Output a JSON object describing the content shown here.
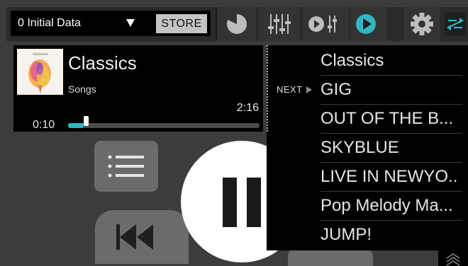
{
  "topbar": {
    "preset_label": "0  Initial Data",
    "store_label": "STORE"
  },
  "toolbar": {
    "icons": [
      "timer-icon",
      "mixer-icon",
      "play-eq-icon",
      "play-icon",
      "gear-icon",
      "swap-icon"
    ],
    "accent": "#2fb7c2"
  },
  "now_playing": {
    "title": "Classics",
    "subtitle": "Songs",
    "elapsed": "0:10",
    "total": "2:16",
    "progress": 0.08
  },
  "queue": {
    "next_label": "NEXT",
    "items": [
      "Classics",
      "GIG",
      "OUT OF THE B...",
      "SKYBLUE",
      "LIVE IN NEWYO..",
      "Pop Melody Ma...",
      "JUMP!"
    ]
  }
}
